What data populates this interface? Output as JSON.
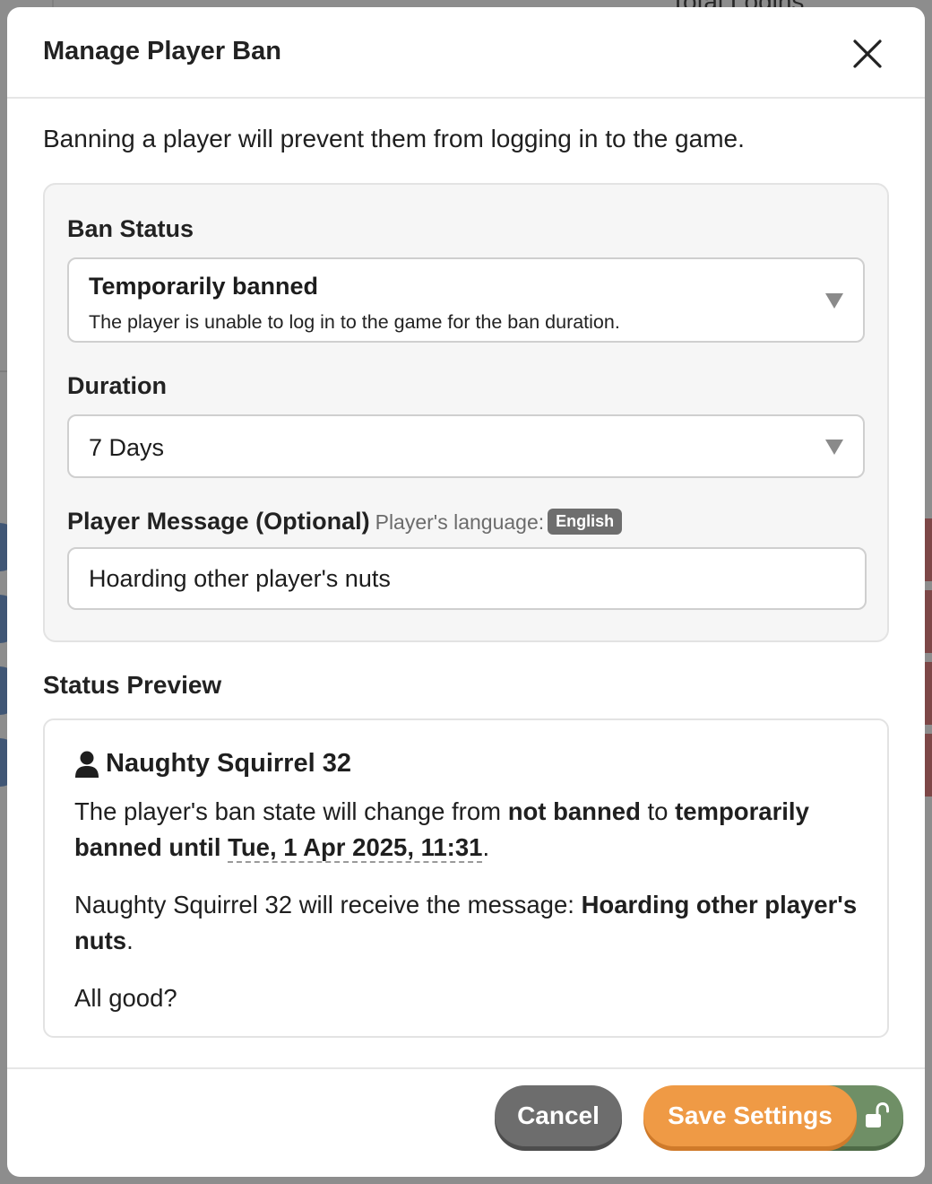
{
  "background": {
    "header_fragment": "Total Logins"
  },
  "modal": {
    "title": "Manage Player Ban",
    "intro": "Banning a player will prevent them from logging in to the game."
  },
  "form": {
    "ban_status": {
      "label": "Ban Status",
      "selected_title": "Temporarily banned",
      "selected_description": "The player is unable to log in to the game for the ban duration."
    },
    "duration": {
      "label": "Duration",
      "selected": "7 Days"
    },
    "player_message": {
      "label": "Player Message (Optional)",
      "language_hint": "Player's language:",
      "language": "English",
      "value": "Hoarding other player's nuts"
    }
  },
  "preview": {
    "heading": "Status Preview",
    "player_name": "Naughty Squirrel 32",
    "line1_prefix": "The player's ban state will change from ",
    "line1_from": "not banned",
    "line1_to_word": " to ",
    "line1_to": "temporarily banned until ",
    "line1_date": "Tue, 1 Apr 2025, 11:31",
    "line1_end": ".",
    "line2_prefix": "Naughty Squirrel 32 will receive the message: ",
    "line2_message": "Hoarding other player's nuts",
    "line2_end": ".",
    "line3": "All good?"
  },
  "footer": {
    "cancel_label": "Cancel",
    "save_label": "Save Settings"
  },
  "colors": {
    "save": "#ef9a45",
    "cancel": "#6d6d6d",
    "lock": "#6f8f66",
    "badge": "#6e6e6e"
  }
}
